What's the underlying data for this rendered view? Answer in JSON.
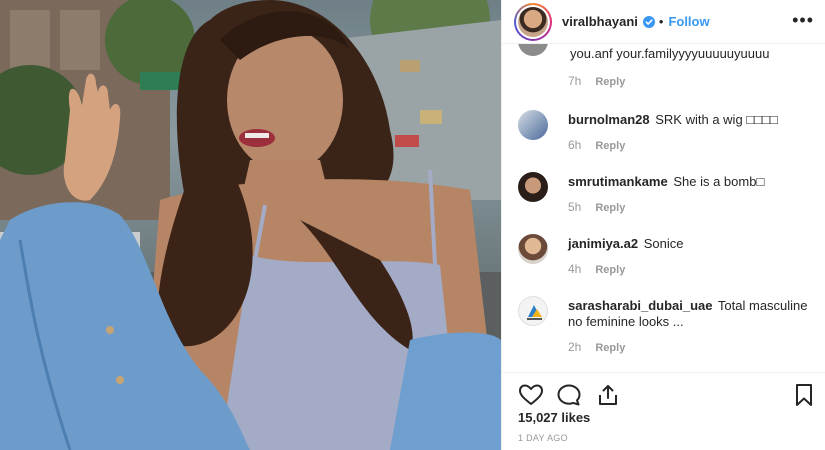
{
  "post": {
    "username": "viralbhayani",
    "follow_label": "Follow",
    "dot": "•",
    "more_label": "•••"
  },
  "comments": [
    {
      "user": "",
      "text": "you.anf your.familyyyyuuuuuyuuuu",
      "time": "7h",
      "reply": "Reply"
    },
    {
      "user": "burnolman28",
      "text": "SRK with a wig □□□□",
      "time": "6h",
      "reply": "Reply"
    },
    {
      "user": "smrutimankame",
      "text": "She is a bomb□",
      "time": "5h",
      "reply": "Reply"
    },
    {
      "user": "janimiya.a2",
      "text": "Sonice",
      "time": "4h",
      "reply": "Reply"
    },
    {
      "user": "sarasharabi_dubai_uae",
      "text": "Total masculine no feminine looks ...",
      "time": "2h",
      "reply": "Reply"
    }
  ],
  "footer": {
    "likes": "15,027 likes",
    "ago": "1 DAY AGO"
  },
  "icons": {
    "like": "heart-icon",
    "comment": "comment-bubble-icon",
    "share": "share-icon",
    "save": "bookmark-icon",
    "verified": "verified-badge-icon"
  },
  "colors": {
    "follow": "#3897f0",
    "verified": "#3897f0",
    "text": "#262626",
    "muted": "#999999",
    "border": "#efefef"
  }
}
